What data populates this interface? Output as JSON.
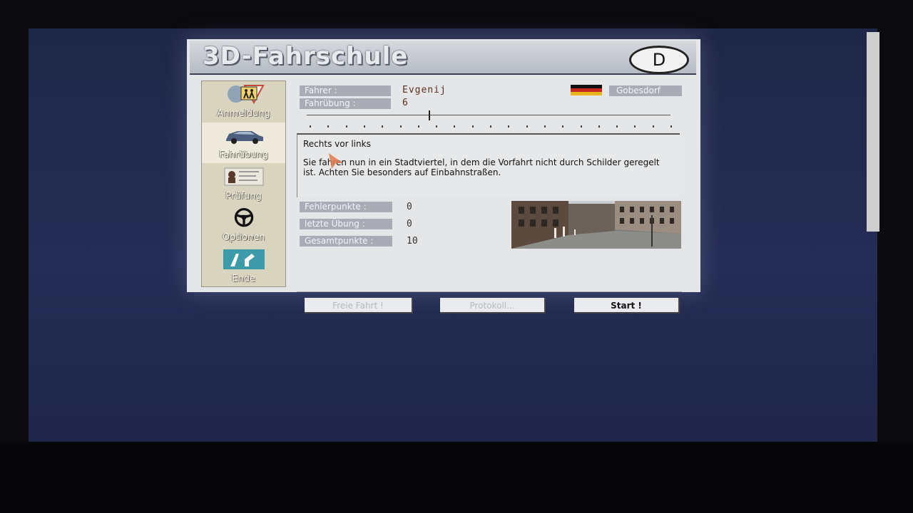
{
  "app": {
    "title": "3D-Fahrschule",
    "lang_badge": "D"
  },
  "sidebar": {
    "items": [
      {
        "label": "Anmeldung",
        "icon": "registration-icon"
      },
      {
        "label": "Fahrübung",
        "icon": "car-icon"
      },
      {
        "label": "Prüfung",
        "icon": "license-card-icon"
      },
      {
        "label": "Optionen",
        "icon": "steering-wheel-icon"
      },
      {
        "label": "Ende",
        "icon": "exit-sign-icon"
      }
    ]
  },
  "driver": {
    "name_label": "Fahrer :",
    "name": "Evgenij",
    "exercise_label": "Fahrübung :",
    "exercise": "6",
    "country_flag": "germany-flag-icon",
    "location": "Gobesdorf"
  },
  "exercise": {
    "title": "Rechts vor links",
    "description": "Sie fahren nun in ein Stadtviertel, in dem die Vorfahrt nicht durch Schilder geregelt ist. Achten Sie besonders auf Einbahnstraßen."
  },
  "stats": [
    {
      "label": "Fehlerpunkte :",
      "value": "0"
    },
    {
      "label": "letzte Übung :",
      "value": "0"
    },
    {
      "label": "Gesamtpunkte :",
      "value": "10"
    }
  ],
  "buttons": {
    "free_drive": "Freie Fahrt !",
    "protocol": "Protokoll...",
    "start": "Start !"
  },
  "colors": {
    "label_bg": "#a9acb4",
    "name_color": "#5a2f1e",
    "screen_bg": "#232b50"
  }
}
